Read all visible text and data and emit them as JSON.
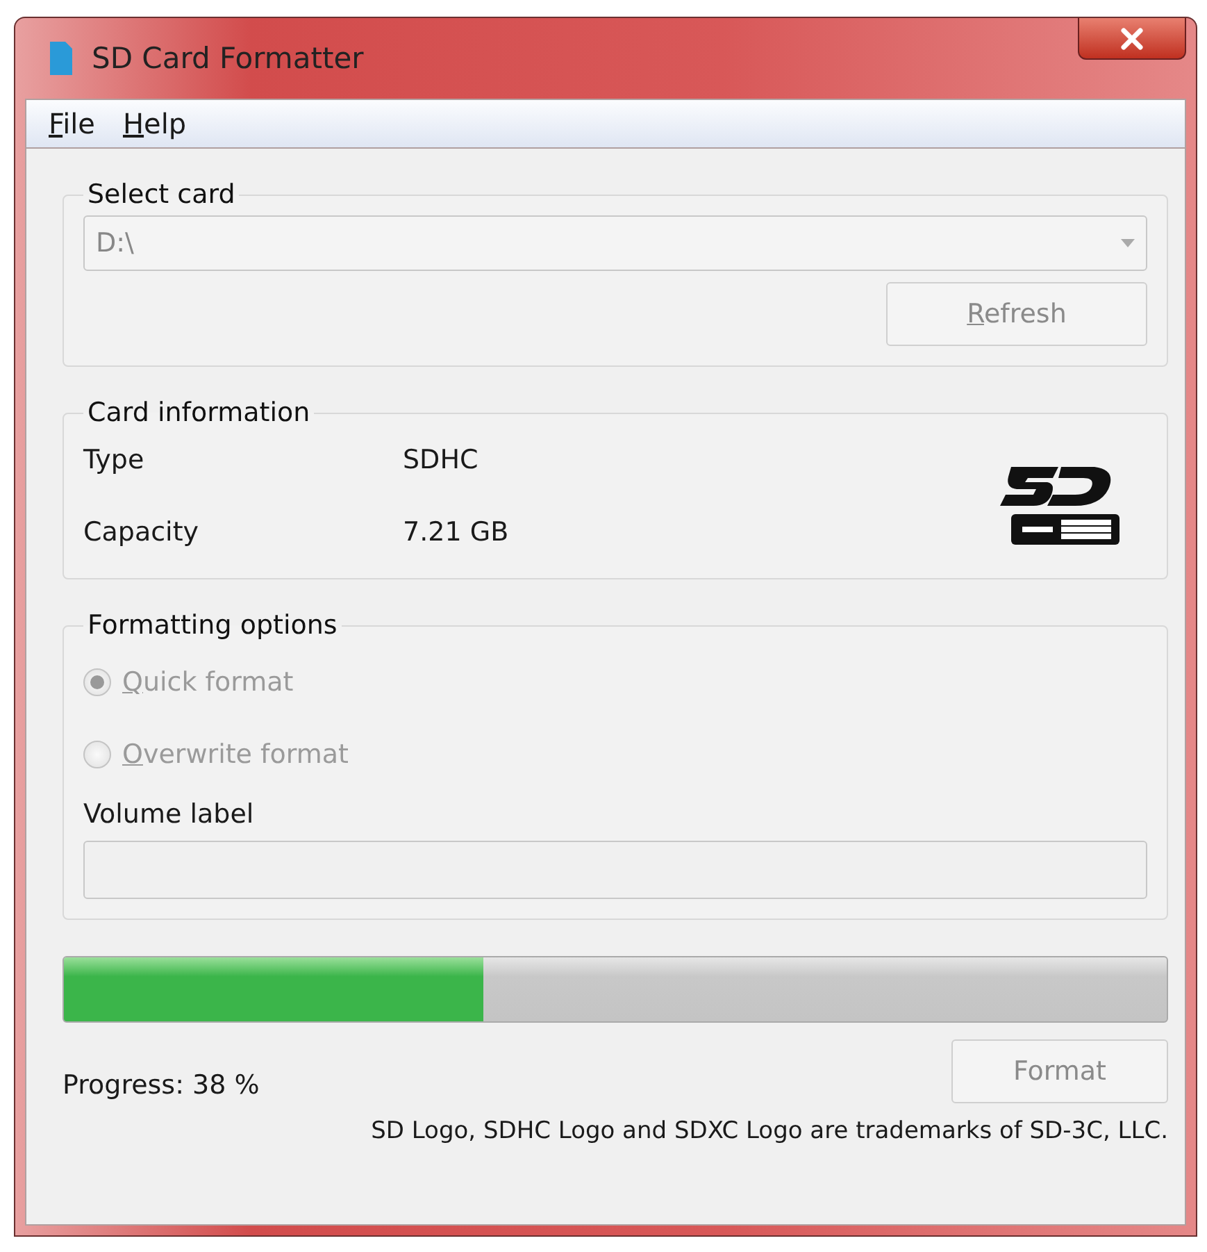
{
  "window": {
    "title": "SD Card Formatter"
  },
  "menu": [
    {
      "label": "File"
    },
    {
      "label": "Help"
    }
  ],
  "select_card": {
    "title": "Select card",
    "drive": "D:\\",
    "drive_disabled": true,
    "refresh_button": {
      "label": "Refresh",
      "disabled": true
    }
  },
  "card_information": {
    "title": "Card information",
    "rows": [
      {
        "label": "Type",
        "value": "SDHC"
      },
      {
        "label": "Capacity",
        "value": "7.21 GB"
      }
    ]
  },
  "formatting_options": {
    "title": "Formatting options",
    "options": [
      {
        "label": "Quick format",
        "selected": true,
        "disabled": true
      },
      {
        "label": "Overwrite format",
        "selected": false,
        "disabled": true
      }
    ],
    "volume_label": {
      "label": "Volume label",
      "disabled": true
    }
  },
  "progress": {
    "level": 0.38,
    "reading": "Progress: 38 %"
  },
  "format_button": {
    "label": "Format",
    "disabled": true
  },
  "footer": "SD Logo, SDHC Logo and SDXC Logo are trademarks of SD-3C, LLC."
}
